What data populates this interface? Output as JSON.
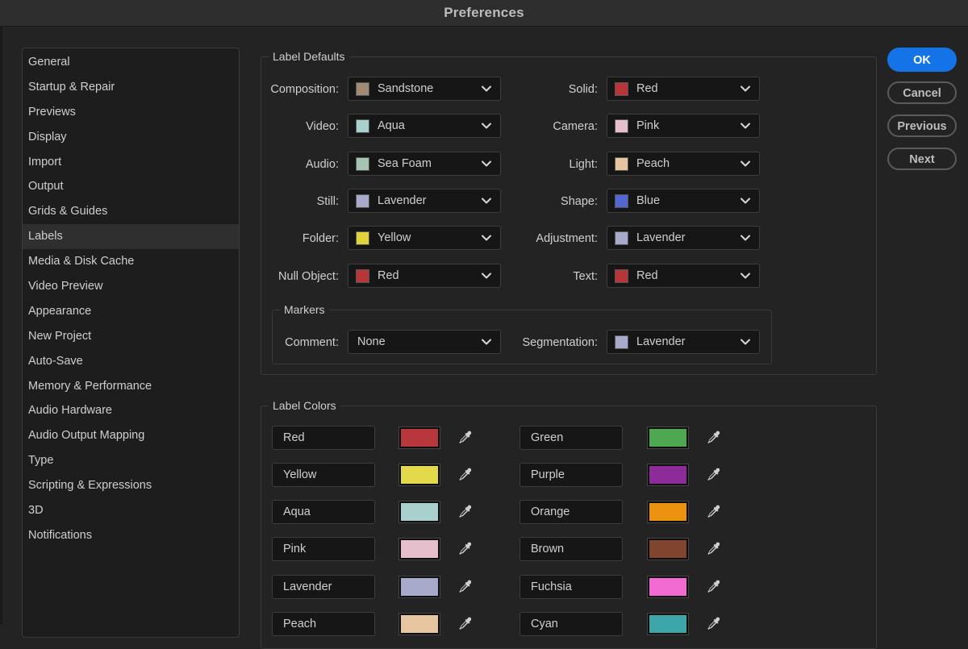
{
  "window": {
    "title": "Preferences"
  },
  "sidebar": {
    "items": [
      {
        "label": "General"
      },
      {
        "label": "Startup & Repair"
      },
      {
        "label": "Previews"
      },
      {
        "label": "Display"
      },
      {
        "label": "Import"
      },
      {
        "label": "Output"
      },
      {
        "label": "Grids & Guides"
      },
      {
        "label": "Labels",
        "selected": true
      },
      {
        "label": "Media & Disk Cache"
      },
      {
        "label": "Video Preview"
      },
      {
        "label": "Appearance"
      },
      {
        "label": "New Project"
      },
      {
        "label": "Auto-Save"
      },
      {
        "label": "Memory & Performance"
      },
      {
        "label": "Audio Hardware"
      },
      {
        "label": "Audio Output Mapping"
      },
      {
        "label": "Type"
      },
      {
        "label": "Scripting & Expressions"
      },
      {
        "label": "3D"
      },
      {
        "label": "Notifications"
      }
    ]
  },
  "label_defaults": {
    "title": "Label Defaults",
    "left": [
      {
        "label": "Composition:",
        "value": "Sandstone",
        "color": "#a08b73"
      },
      {
        "label": "Video:",
        "value": "Aqua",
        "color": "#a9d0cd"
      },
      {
        "label": "Audio:",
        "value": "Sea Foam",
        "color": "#a6c4b2"
      },
      {
        "label": "Still:",
        "value": "Lavender",
        "color": "#a8aacb"
      },
      {
        "label": "Folder:",
        "value": "Yellow",
        "color": "#e2d33d"
      },
      {
        "label": "Null Object:",
        "value": "Red",
        "color": "#b8353a"
      }
    ],
    "right": [
      {
        "label": "Solid:",
        "value": "Red",
        "color": "#b8353a"
      },
      {
        "label": "Camera:",
        "value": "Pink",
        "color": "#e6bfcd"
      },
      {
        "label": "Light:",
        "value": "Peach",
        "color": "#e8c5a1"
      },
      {
        "label": "Shape:",
        "value": "Blue",
        "color": "#5367d3"
      },
      {
        "label": "Adjustment:",
        "value": "Lavender",
        "color": "#a8aacb"
      },
      {
        "label": "Text:",
        "value": "Red",
        "color": "#b8353a"
      }
    ]
  },
  "markers": {
    "title": "Markers",
    "comment": {
      "label": "Comment:",
      "value": "None"
    },
    "segmentation": {
      "label": "Segmentation:",
      "value": "Lavender",
      "color": "#a8aacb"
    }
  },
  "buttons": {
    "ok": "OK",
    "cancel": "Cancel",
    "previous": "Previous",
    "next": "Next"
  },
  "label_colors": {
    "title": "Label Colors",
    "left": [
      {
        "name": "Red",
        "color": "#b8373d"
      },
      {
        "name": "Yellow",
        "color": "#e4d94a"
      },
      {
        "name": "Aqua",
        "color": "#a9d0cd"
      },
      {
        "name": "Pink",
        "color": "#e6bfcd"
      },
      {
        "name": "Lavender",
        "color": "#a8aacb"
      },
      {
        "name": "Peach",
        "color": "#e8c5a1"
      }
    ],
    "right": [
      {
        "name": "Green",
        "color": "#4ea852"
      },
      {
        "name": "Purple",
        "color": "#8d2c99"
      },
      {
        "name": "Orange",
        "color": "#eb9211"
      },
      {
        "name": "Brown",
        "color": "#7f452e"
      },
      {
        "name": "Fuchsia",
        "color": "#f26bd3"
      },
      {
        "name": "Cyan",
        "color": "#3ca6a9"
      }
    ]
  }
}
